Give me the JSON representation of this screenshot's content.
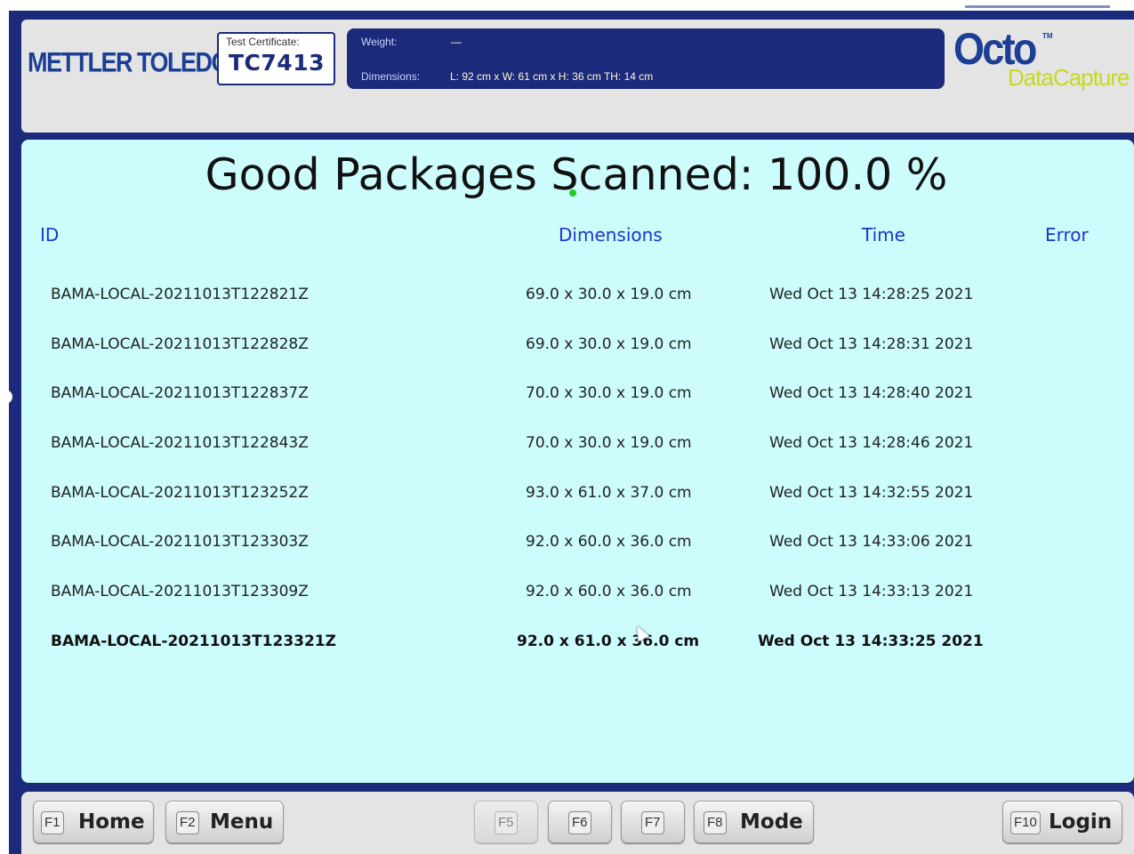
{
  "header": {
    "logo": "METTLER TOLEDO",
    "certificate": {
      "label": "Test Certificate:",
      "code": "TC7413"
    },
    "weight": {
      "label": "Weight:",
      "value": "—"
    },
    "dimensions": {
      "label": "Dimensions:",
      "value": "L: 92 cm x W: 61 cm x H: 36 cm TH: 14 cm"
    },
    "brand": {
      "name": "Octo",
      "tm": "TM",
      "sub": "DataCapture"
    }
  },
  "main": {
    "title": "Good Packages Scanned:",
    "percentage": "100.0 %",
    "columns": {
      "id": "ID",
      "dimensions": "Dimensions",
      "time": "Time",
      "error": "Error"
    },
    "rows": [
      {
        "id": "BAMA-LOCAL-20211013T122821Z",
        "dimensions": "69.0 x 30.0 x 19.0 cm",
        "time": "Wed Oct 13 14:28:25 2021",
        "error": ""
      },
      {
        "id": "BAMA-LOCAL-20211013T122828Z",
        "dimensions": "69.0 x 30.0 x 19.0 cm",
        "time": "Wed Oct 13 14:28:31 2021",
        "error": ""
      },
      {
        "id": "BAMA-LOCAL-20211013T122837Z",
        "dimensions": "70.0 x 30.0 x 19.0 cm",
        "time": "Wed Oct 13 14:28:40 2021",
        "error": ""
      },
      {
        "id": "BAMA-LOCAL-20211013T122843Z",
        "dimensions": "70.0 x 30.0 x 19.0 cm",
        "time": "Wed Oct 13 14:28:46 2021",
        "error": ""
      },
      {
        "id": "BAMA-LOCAL-20211013T123252Z",
        "dimensions": "93.0 x 61.0 x 37.0 cm",
        "time": "Wed Oct 13 14:32:55 2021",
        "error": ""
      },
      {
        "id": "BAMA-LOCAL-20211013T123303Z",
        "dimensions": "92.0 x 60.0 x 36.0 cm",
        "time": "Wed Oct 13 14:33:06 2021",
        "error": ""
      },
      {
        "id": "BAMA-LOCAL-20211013T123309Z",
        "dimensions": "92.0 x 60.0 x 36.0 cm",
        "time": "Wed Oct 13 14:33:13 2021",
        "error": ""
      },
      {
        "id": "BAMA-LOCAL-20211013T123321Z",
        "dimensions": "92.0 x 61.0 x 36.0 cm",
        "time": "Wed Oct 13 14:33:25 2021",
        "error": ""
      }
    ]
  },
  "footer": {
    "keys": [
      {
        "code": "F1",
        "label": "Home",
        "enabled": true
      },
      {
        "code": "F2",
        "label": "Menu",
        "enabled": true
      },
      {
        "code": "F5",
        "label": "",
        "enabled": false
      },
      {
        "code": "F6",
        "label": "",
        "enabled": true
      },
      {
        "code": "F7",
        "label": "",
        "enabled": true
      },
      {
        "code": "F8",
        "label": "Mode",
        "enabled": true
      },
      {
        "code": "F10",
        "label": "Login",
        "enabled": true
      }
    ]
  }
}
